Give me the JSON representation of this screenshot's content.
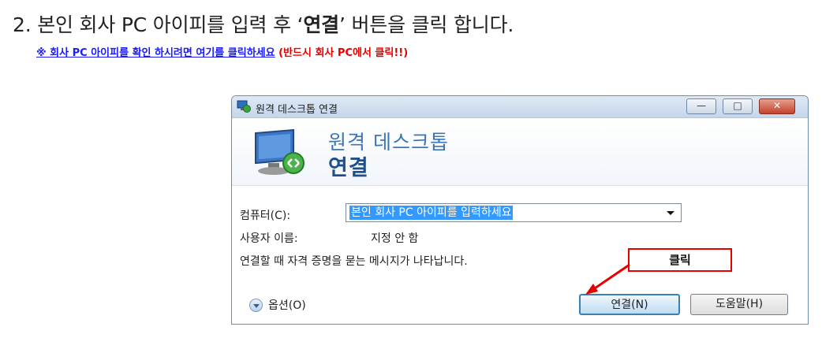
{
  "instruction": {
    "step_text": "2. 본인 회사 PC 아이피를 입력 후 ‘",
    "step_bold": "연결",
    "step_text_end": "’ 버튼을 클릭 합니다.",
    "notice_link": "※ 회사 PC 아이피를 확인 하시려면 여기를 클릭하세요",
    "notice_warn": " (반드시 회사 PC에서 클릭!!)"
  },
  "dialog": {
    "title": "원격 데스크톱 연결",
    "window_buttons": {
      "minimize": "—",
      "maximize": "□",
      "close": "✕"
    },
    "header_sub": "원격 데스크톱",
    "header_main": "연결",
    "computer_label": "컴퓨터(C):",
    "computer_value": "본인 회사 PC 아이피를 입력하세요",
    "user_label": "사용자 이름:",
    "user_value": "지정 안 함",
    "info_text": "연결할 때 자격 증명을 묻는 메시지가 나타납니다.",
    "options_label": "옵션(O)",
    "connect_button": "연결(N)",
    "help_button": "도움말(H)"
  },
  "callout": {
    "label": "클릭"
  },
  "colors": {
    "link": "#1a1aff",
    "warning": "#e60000",
    "header_sub": "#3a76b8",
    "header_main": "#1d4f8c",
    "selection": "#3399ff"
  },
  "icons": {
    "app": "remote-desktop-icon",
    "header": "monitor-icon",
    "options": "expand-circle-icon"
  }
}
